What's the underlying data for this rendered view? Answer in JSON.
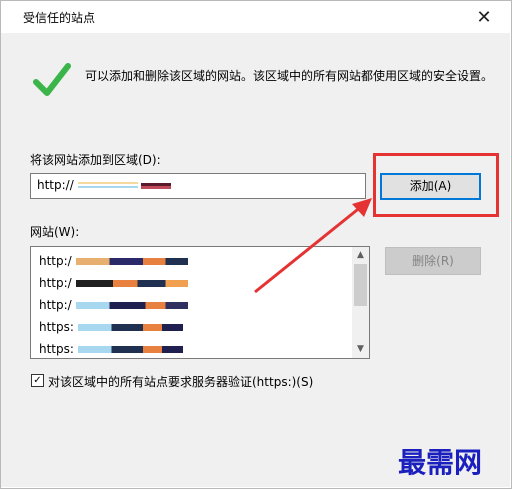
{
  "window": {
    "title": "受信任的站点",
    "close_label": "✕"
  },
  "info": {
    "text": "可以添加和删除该区域的网站。该区域中的所有网站都使用区域的安全设置。"
  },
  "add_site": {
    "label": "将该网站添加到区域(D):",
    "value": "http://",
    "button": "添加(A)"
  },
  "sites": {
    "label": "网站(W):",
    "remove_button": "删除(R)",
    "items": [
      {
        "prefix": "http:/"
      },
      {
        "prefix": "http:/"
      },
      {
        "prefix": "http:/"
      },
      {
        "prefix": "https:"
      },
      {
        "prefix": "https:"
      }
    ]
  },
  "https_check": {
    "checked": true,
    "mark": "✓",
    "label": "对该区域中的所有站点要求服务器验证(https:)(S)"
  },
  "watermark": "最需网",
  "colors": {
    "accent": "#0078d7",
    "annotation": "#e53333",
    "checkmark": "#3bb54a",
    "watermark": "#1a1fbd"
  }
}
